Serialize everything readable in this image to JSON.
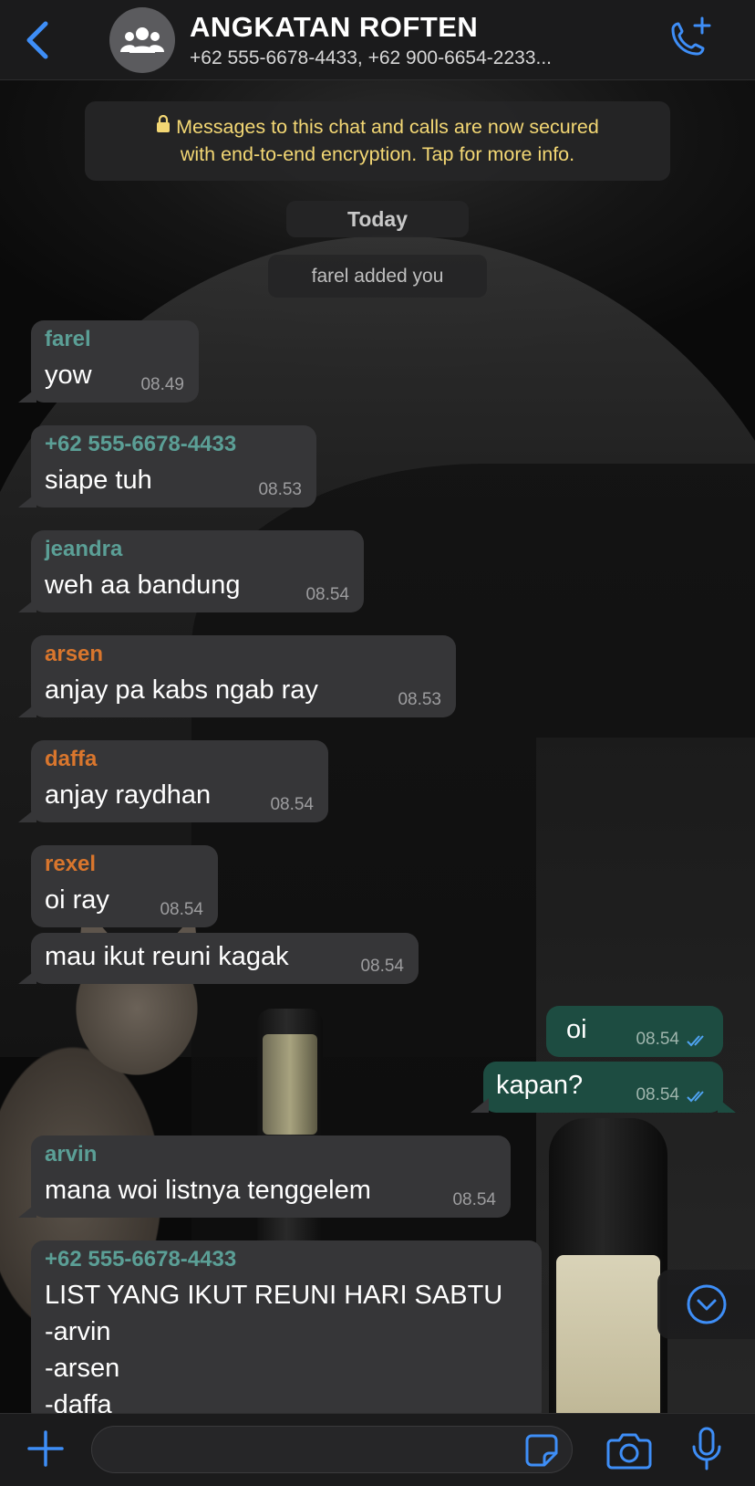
{
  "header": {
    "title": "ANGKATAN ROFTEN",
    "subtitle": "+62 555-6678-4433, +62 900-6654-2233...",
    "back_icon": "chevron-left-icon",
    "avatar_icon": "group-icon",
    "call_icon": "phone-add-icon"
  },
  "notices": {
    "encryption_line1": "Messages to this chat and calls are now secured",
    "encryption_line2": "with end-to-end encryption. Tap for more info.",
    "day": "Today",
    "added": "farel added you"
  },
  "messages": [
    {
      "sender": "farel",
      "text": "yow",
      "time": "08.49"
    },
    {
      "sender": "+62 555-6678-4433",
      "text": "siape tuh",
      "time": "08.53"
    },
    {
      "sender": "jeandra",
      "text": "weh aa bandung",
      "time": "08.54"
    },
    {
      "sender": "arsen",
      "text": " anjay pa kabs ngab ray",
      "time": "08.53"
    },
    {
      "sender": "daffa",
      "text": "anjay raydhan",
      "time": "08.54"
    },
    {
      "sender": "rexel",
      "text": "oi ray",
      "time": "08.54"
    },
    {
      "sender": "",
      "text": "mau ikut reuni kagak",
      "time": "08.54"
    },
    {
      "sender": "",
      "text": "oi",
      "time": "08.54",
      "outgoing": true
    },
    {
      "sender": "",
      "text": "kapan?",
      "time": "08.54",
      "outgoing": true
    },
    {
      "sender": "arvin",
      "text": "mana woi listnya tenggelem",
      "time": "08.54"
    },
    {
      "sender": "+62 555-6678-4433",
      "lines": [
        "LIST YANG IKUT REUNI HARI SABTU",
        "-arvin",
        "-arsen",
        "-daffa"
      ]
    }
  ],
  "composer": {
    "placeholder": "",
    "plus_icon": "plus-icon",
    "sticker_icon": "sticker-icon",
    "camera_icon": "camera-icon",
    "mic_icon": "microphone-icon"
  },
  "colors": {
    "accent": "#3e8ef7",
    "incoming_bubble": "#363638",
    "outgoing_bubble": "#1d4c41",
    "sender_green": "#5b9f96",
    "sender_orange": "#d9762d",
    "encryption_text": "#f3d774"
  }
}
